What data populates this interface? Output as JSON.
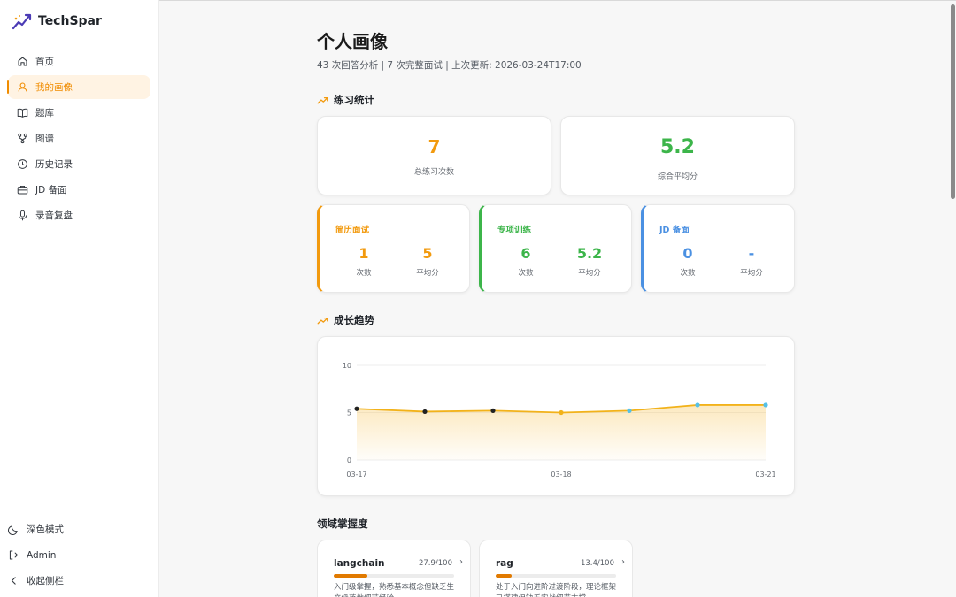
{
  "app": {
    "name": "TechSpar"
  },
  "sidebar": {
    "items": [
      {
        "label": "首页",
        "icon": "home-icon",
        "active": false
      },
      {
        "label": "我的画像",
        "icon": "user-icon",
        "active": true
      },
      {
        "label": "题库",
        "icon": "book-icon",
        "active": false
      },
      {
        "label": "图谱",
        "icon": "graph-icon",
        "active": false
      },
      {
        "label": "历史记录",
        "icon": "clock-icon",
        "active": false
      },
      {
        "label": "JD 备面",
        "icon": "briefcase-icon",
        "active": false
      },
      {
        "label": "录音复盘",
        "icon": "mic-icon",
        "active": false
      }
    ],
    "bottom": {
      "dark_mode": "深色模式",
      "user": "Admin",
      "collapse": "收起侧栏"
    }
  },
  "header": {
    "title": "个人画像",
    "subtitle": "43 次回答分析 | 7 次完整面试 | 上次更新: 2026-03-24T17:00"
  },
  "practice": {
    "heading": "练习统计",
    "total": {
      "value": "7",
      "label": "总练习次数"
    },
    "average": {
      "value": "5.2",
      "label": "综合平均分"
    },
    "modes": [
      {
        "title": "简历面试",
        "count": "1",
        "count_label": "次数",
        "avg": "5",
        "avg_label": "平均分",
        "color": "#f29a0e"
      },
      {
        "title": "专项训练",
        "count": "6",
        "count_label": "次数",
        "avg": "5.2",
        "avg_label": "平均分",
        "color": "#3cb54a"
      },
      {
        "title": "JD 备面",
        "count": "0",
        "count_label": "次数",
        "avg": "-",
        "avg_label": "平均分",
        "color": "#4a90e2"
      }
    ]
  },
  "growth": {
    "heading": "成长趋势"
  },
  "chart_data": {
    "type": "area",
    "title": "",
    "xlabel": "",
    "ylabel": "",
    "ylim": [
      0,
      10
    ],
    "yticks": [
      "0",
      "5",
      "10"
    ],
    "x_tick_labels": [
      "03-17",
      "03-18",
      "03-21"
    ],
    "values": [
      5.4,
      5.1,
      5.2,
      5.0,
      5.2,
      5.8,
      5.8
    ],
    "point_colors": [
      "#222222",
      "#222222",
      "#222222",
      "#f2b21a",
      "#55c1e8",
      "#55c1e8",
      "#55c1e8"
    ],
    "line_color": "#f2b21a",
    "grid": true
  },
  "domains": {
    "heading": "领域掌握度",
    "items": [
      {
        "name": "langchain",
        "score": "27.9/100",
        "fraction": 0.279,
        "desc": "入门级掌握，熟悉基本概念但缺乏生产级落地细节经验"
      },
      {
        "name": "rag",
        "score": "13.4/100",
        "fraction": 0.134,
        "desc": "处于入门向进阶过渡阶段，理论框架已搭建但缺乏实战细节支撑"
      }
    ]
  }
}
